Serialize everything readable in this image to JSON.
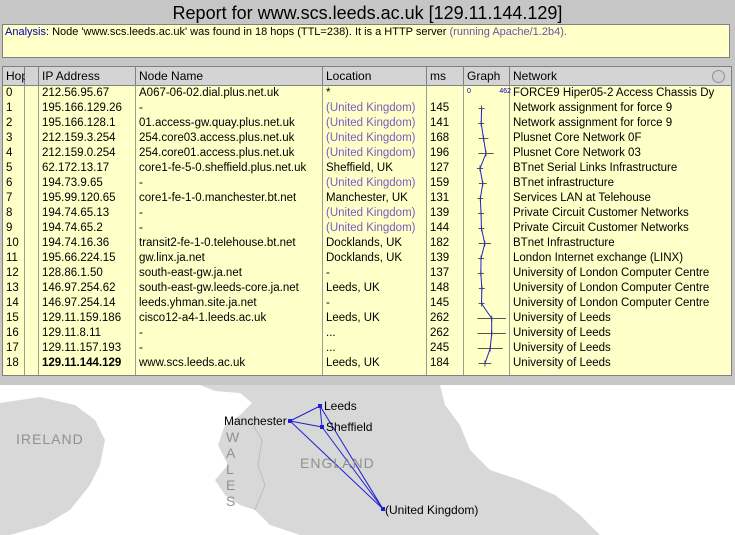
{
  "title": "Report for www.scs.leeds.ac.uk [129.11.144.129]",
  "analysis": {
    "label": "Analysis",
    "text": ": Node 'www.scs.leeds.ac.uk' was found in 18 hops (TTL=238). It is a HTTP server",
    "server": " (running Apache/1.2b4)."
  },
  "columns": [
    "Hop",
    "",
    "IP Address",
    "Node Name",
    "Location",
    "ms",
    "Graph",
    "Network"
  ],
  "graph_scale": {
    "min": "0",
    "max": "462"
  },
  "rows": [
    {
      "hop": "0",
      "ip": "212.56.95.67",
      "node": "A067-06-02.dial.plus.net.uk",
      "loc": "*",
      "uk": false,
      "ms": "",
      "net": "FORCE9 Hiper05-2 Access Chassis Dy"
    },
    {
      "hop": "1",
      "ip": "195.166.129.26",
      "node": "-",
      "loc": "(United Kingdom)",
      "uk": true,
      "ms": "145",
      "net": "Network assignment for force 9"
    },
    {
      "hop": "2",
      "ip": "195.166.128.1",
      "node": "01.access-gw.quay.plus.net.uk",
      "loc": "(United Kingdom)",
      "uk": true,
      "ms": "141",
      "net": "Network assignment for force 9"
    },
    {
      "hop": "3",
      "ip": "212.159.3.254",
      "node": "254.core03.access.plus.net.uk",
      "loc": "(United Kingdom)",
      "uk": true,
      "ms": "168",
      "net": "Plusnet Core Network 0F"
    },
    {
      "hop": "4",
      "ip": "212.159.0.254",
      "node": "254.core01.access.plus.net.uk",
      "loc": "(United Kingdom)",
      "uk": true,
      "ms": "196",
      "net": "Plusnet Core Network 03"
    },
    {
      "hop": "5",
      "ip": "62.172.13.17",
      "node": "core1-fe-5-0.sheffield.plus.net.uk",
      "loc": "Sheffield, UK",
      "uk": false,
      "ms": "127",
      "net": "BTnet Serial Links Infrastructure"
    },
    {
      "hop": "6",
      "ip": "194.73.9.65",
      "node": "-",
      "loc": "(United Kingdom)",
      "uk": true,
      "ms": "159",
      "net": "BTnet infrastructure"
    },
    {
      "hop": "7",
      "ip": "195.99.120.65",
      "node": "core1-fe-1-0.manchester.bt.net",
      "loc": "Manchester, UK",
      "uk": false,
      "ms": "131",
      "net": "Services LAN at Telehouse"
    },
    {
      "hop": "8",
      "ip": "194.74.65.13",
      "node": "-",
      "loc": "(United Kingdom)",
      "uk": true,
      "ms": "139",
      "net": "Private Circuit Customer Networks"
    },
    {
      "hop": "9",
      "ip": "194.74.65.2",
      "node": "-",
      "loc": "(United Kingdom)",
      "uk": true,
      "ms": "144",
      "net": "Private Circuit Customer Networks"
    },
    {
      "hop": "10",
      "ip": "194.74.16.36",
      "node": "transit2-fe-1-0.telehouse.bt.net",
      "loc": "Docklands, UK",
      "uk": false,
      "ms": "182",
      "net": "BTnet Infrastructure"
    },
    {
      "hop": "11",
      "ip": "195.66.224.15",
      "node": "gw.linx.ja.net",
      "loc": "Docklands, UK",
      "uk": false,
      "ms": "139",
      "net": "London Internet exchange (LINX)"
    },
    {
      "hop": "12",
      "ip": "128.86.1.50",
      "node": "south-east-gw.ja.net",
      "loc": "-",
      "uk": false,
      "ms": "137",
      "net": "University of London Computer Centre"
    },
    {
      "hop": "13",
      "ip": "146.97.254.62",
      "node": "south-east-gw.leeds-core.ja.net",
      "loc": "Leeds, UK",
      "uk": false,
      "ms": "148",
      "net": "University of London Computer Centre"
    },
    {
      "hop": "14",
      "ip": "146.97.254.14",
      "node": "leeds.yhman.site.ja.net",
      "loc": "-",
      "uk": false,
      "ms": "145",
      "net": "University of London Computer Centre"
    },
    {
      "hop": "15",
      "ip": "129.11.159.186",
      "node": "cisco12-a4-1.leeds.ac.uk",
      "loc": "Leeds, UK",
      "uk": false,
      "ms": "262",
      "net": "University of Leeds"
    },
    {
      "hop": "16",
      "ip": "129.11.8.11",
      "node": "-",
      "loc": "...",
      "uk": false,
      "ms": "262",
      "net": "University of Leeds"
    },
    {
      "hop": "17",
      "ip": "129.11.157.193",
      "node": "-",
      "loc": "...",
      "uk": false,
      "ms": "245",
      "net": "University of Leeds"
    },
    {
      "hop": "18",
      "ip": "129.11.144.129",
      "node": "www.scs.leeds.ac.uk",
      "loc": "Leeds, UK",
      "uk": false,
      "ms": "184",
      "net": "University of Leeds",
      "bold": true
    }
  ],
  "map": {
    "regions": [
      "IRELAND",
      "WALES",
      "ENGLAND"
    ],
    "cities": [
      "Manchester",
      "Leeds",
      "Sheffield",
      "(United Kingdom)"
    ]
  },
  "colors": {
    "panel": "#ffffc8",
    "route": "#2020d0",
    "uk_text": "#7a5cc2"
  }
}
